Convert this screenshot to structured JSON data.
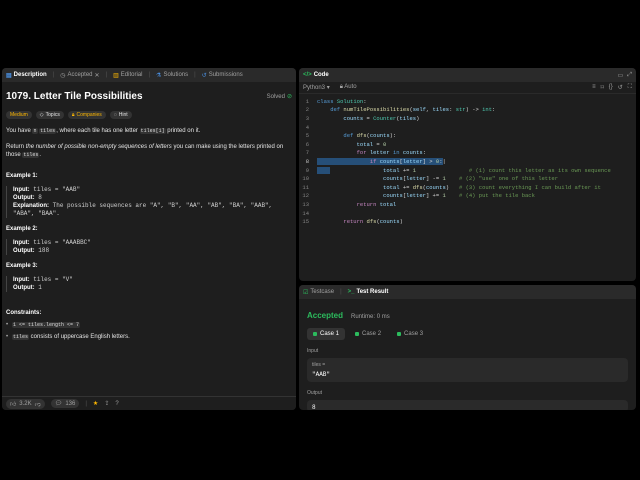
{
  "left": {
    "tabs": [
      {
        "label": "Description"
      },
      {
        "label": "Accepted"
      },
      {
        "label": "Editorial"
      },
      {
        "label": "Solutions"
      },
      {
        "label": "Submissions"
      }
    ],
    "title": "1079. Letter Tile Possibilities",
    "solved": "Solved",
    "badges": {
      "difficulty": "Medium",
      "topics": "Topics",
      "companies": "Companies",
      "hint": "Hint"
    },
    "p1": {
      "a": "You have ",
      "code1": "n",
      "b": " ",
      "code2": "tiles",
      "c": ", where each tile has one letter ",
      "code3": "tiles[i]",
      "d": " printed on it."
    },
    "p2": {
      "a": "Return ",
      "em": "the number of possible non-empty sequences of letters",
      "b": " you can make using the letters printed on those ",
      "code": "tiles",
      "c": "."
    },
    "examples": [
      {
        "heading": "Example 1:",
        "input_label": "Input:",
        "input": " tiles = \"AAB\"",
        "output_label": "Output:",
        "output": " 8",
        "expl_label": "Explanation:",
        "expl": " The possible sequences are \"A\", \"B\", \"AA\", \"AB\", \"BA\", \"AAB\", \"ABA\", \"BAA\"."
      },
      {
        "heading": "Example 2:",
        "input_label": "Input:",
        "input": " tiles = \"AAABBC\"",
        "output_label": "Output:",
        "output": " 188"
      },
      {
        "heading": "Example 3:",
        "input_label": "Input:",
        "input": " tiles = \"V\"",
        "output_label": "Output:",
        "output": " 1"
      }
    ],
    "constraints_heading": "Constraints:",
    "constraints": [
      {
        "code": "1 <= tiles.length <= 7",
        "text": ""
      },
      {
        "code": "tiles",
        "text": " consists of uppercase English letters."
      }
    ],
    "footer": {
      "likes": "3.2K",
      "comments": "136"
    }
  },
  "code": {
    "tab": "Code",
    "language": "Python3",
    "mode": "Auto",
    "lines": [
      {
        "n": "1"
      },
      {
        "n": "2"
      },
      {
        "n": "3"
      },
      {
        "n": "4"
      },
      {
        "n": "5"
      },
      {
        "n": "6"
      },
      {
        "n": "7"
      },
      {
        "n": "8"
      },
      {
        "n": "9"
      },
      {
        "n": "10"
      },
      {
        "n": "11"
      },
      {
        "n": "12"
      },
      {
        "n": "13"
      },
      {
        "n": "14"
      },
      {
        "n": "15"
      }
    ]
  },
  "result": {
    "tabs": [
      {
        "label": "Testcase"
      },
      {
        "label": "Test Result"
      }
    ],
    "status": "Accepted",
    "runtime": "Runtime: 0 ms",
    "cases": [
      {
        "label": "Case 1"
      },
      {
        "label": "Case 2"
      },
      {
        "label": "Case 3"
      }
    ],
    "input_label": "Input",
    "param": "tiles =",
    "param_value": "\"AAB\"",
    "output_label": "Output",
    "output_value": "8"
  },
  "colors": {
    "accent_green": "#2cbb5d",
    "medium": "#ffb800",
    "selection": "#264f78"
  }
}
